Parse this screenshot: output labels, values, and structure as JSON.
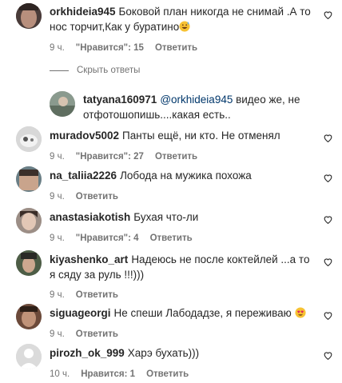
{
  "colors": {
    "text": "#262626",
    "meta": "#737373",
    "mention": "#00376b"
  },
  "comments": [
    {
      "username": "orkhideia945",
      "text": "Боковой план никогда не снимай .А то нос торчит,Как у буратино",
      "emoji": "grinning-sweat-face",
      "time": "9 ч.",
      "likes": "\"Нравится\": 15",
      "reply": "Ответить"
    },
    {
      "username": "tatyana160971",
      "mention": "@orkhideia945",
      "text": " видео же, не отфотошопишь....какая есть..",
      "time": "",
      "likes": "",
      "reply": ""
    },
    {
      "username": "muradov5002",
      "text": "Панты ещё, ни кто. Не отменял",
      "time": "9 ч.",
      "likes": "\"Нравится\": 27",
      "reply": "Ответить"
    },
    {
      "username": "na_taliia2226",
      "text": "Лобода на мужика похожа",
      "time": "9 ч.",
      "reply": "Ответить"
    },
    {
      "username": "anastasiakotish",
      "text": "Бухая что-ли",
      "time": "9 ч.",
      "likes": "\"Нравится\": 4",
      "reply": "Ответить"
    },
    {
      "username": "kiyashenko_art",
      "text": "Надеюсь не после коктейлей ...а то я сяду за руль !!!)))",
      "time": "9 ч.",
      "reply": "Ответить"
    },
    {
      "username": "siguageorgi",
      "text": "Не спеши Лабодадзе, я переживаю",
      "emoji": "heart-eyes-face",
      "time": "9 ч.",
      "reply": "Ответить"
    },
    {
      "username": "pirozh_ok_999",
      "text": "Харэ бухать)))",
      "time": "10 ч.",
      "likes": "Нравится: 1",
      "reply": "Ответить"
    }
  ],
  "hide_replies_label": "Скрыть ответы",
  "icons": {
    "like": "heart-outline-icon",
    "avatar": "user-avatar"
  }
}
